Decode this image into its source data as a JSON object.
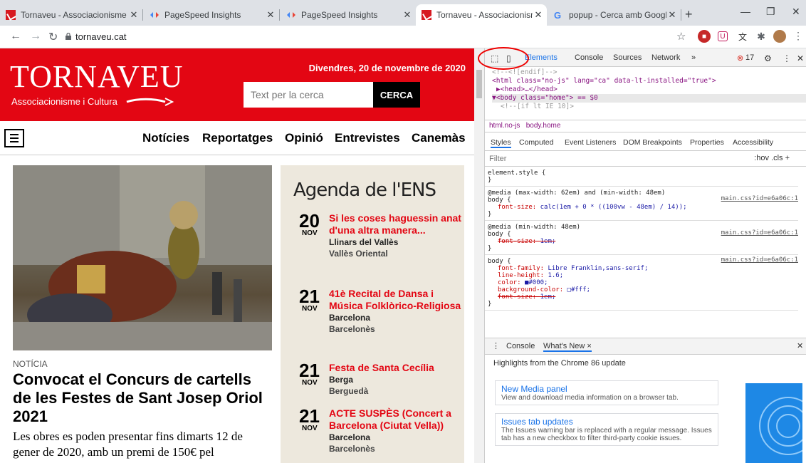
{
  "tabs": [
    {
      "title": "Tornaveu - Associacionisme i C",
      "icon": "tornaveu-favicon"
    },
    {
      "title": "PageSpeed Insights",
      "icon": "pagespeed-favicon"
    },
    {
      "title": "PageSpeed Insights",
      "icon": "pagespeed-favicon"
    },
    {
      "title": "Tornaveu - Associacionisme i C",
      "icon": "tornaveu-favicon",
      "active": true
    },
    {
      "title": "popup - Cerca amb Google",
      "icon": "google-favicon"
    }
  ],
  "address": {
    "url": "tornaveu.cat"
  },
  "site": {
    "logo": "TORNAVEU",
    "tagline": "Associacionisme i Cultura",
    "date": "Divendres, 20 de novembre de 2020",
    "search_placeholder": "Text per la cerca",
    "search_button": "CERCA",
    "nav": [
      "Notícies",
      "Reportatges",
      "Opinió",
      "Entrevistes",
      "Canemàs"
    ],
    "article": {
      "kicker": "NOTÍCIA",
      "headline": "Convocat el Concurs de cartells de les Festes de Sant Josep Oriol 2021",
      "lede": "Les obres es poden presentar fins dimarts 12 de gener de 2020, amb un premi de 150€ pel"
    },
    "agenda": {
      "title": "Agenda de l'ENS",
      "events": [
        {
          "day": "20",
          "month": "NOV",
          "title": "Si les coses haguessin anat d'una altra manera...",
          "place": "Llinars del Vallès",
          "region": "Vallès Oriental"
        },
        {
          "day": "21",
          "month": "NOV",
          "title": "41è Recital de Dansa i Música Folklòrico-Religiosa",
          "place": "Barcelona",
          "region": "Barcelonès"
        },
        {
          "day": "21",
          "month": "NOV",
          "title": "Festa de Santa Cecília",
          "place": "Berga",
          "region": "Berguedà"
        },
        {
          "day": "21",
          "month": "NOV",
          "title": "ACTE SUSPÈS (Concert a Barcelona (Ciutat Vella))",
          "place": "Barcelona",
          "region": "Barcelonès"
        }
      ]
    }
  },
  "devtools": {
    "tabs": [
      "Elements",
      "Console",
      "Sources",
      "Network",
      "»"
    ],
    "error_count": "17",
    "dom_lines": [
      "<!--<![endif]-->",
      "<html class=\"no-js\" lang=\"ca\" data-lt-installed=\"true\">",
      "▶<head>…</head>",
      "▼<body class=\"home\"> == $0",
      "<!--[if lt IE 10]>"
    ],
    "breadcrumbs": [
      "html.no-js",
      "body.home"
    ],
    "subtabs": [
      "Styles",
      "Computed",
      "Event Listeners",
      "DOM Breakpoints",
      "Properties",
      "Accessibility"
    ],
    "filter_placeholder": "Filter",
    "filter_tools": ":hov  .cls  +",
    "rules": [
      {
        "header": "element.style {",
        "props": [],
        "src": ""
      },
      {
        "header": "@media (max-width: 62em) and (min-width: 48em)",
        "selector": "body {",
        "props": [
          {
            "name": "font-size",
            "value": "calc(1em + 0 * ((100vw - 48em) / 14));"
          }
        ],
        "src": "main.css?id=e6a06c:1"
      },
      {
        "header": "@media (min-width: 48em)",
        "selector": "body {",
        "props": [
          {
            "name": "font-size",
            "value": "1em;",
            "struck": true
          }
        ],
        "src": "main.css?id=e6a06c:1"
      },
      {
        "header": "",
        "selector": "body {",
        "props": [
          {
            "name": "font-family",
            "value": "Libre Franklin,sans-serif;"
          },
          {
            "name": "line-height",
            "value": "1.6;"
          },
          {
            "name": "color",
            "value": "■#000;"
          },
          {
            "name": "background-color",
            "value": "□#fff;"
          },
          {
            "name": "font-size",
            "value": "1em;",
            "struck": true
          }
        ],
        "src": "main.css?id=e6a06c:1"
      }
    ],
    "drawer": {
      "tabs": [
        "Console",
        "What's New ×"
      ],
      "highlight": "Highlights from the Chrome 86 update"
    },
    "whats_new": [
      {
        "title": "New Media panel",
        "desc": "View and download media information on a browser tab."
      },
      {
        "title": "Issues tab updates",
        "desc": "The Issues warning bar is replaced with a regular message. Issues tab has a new checkbox to filter third-party cookie issues."
      }
    ]
  }
}
